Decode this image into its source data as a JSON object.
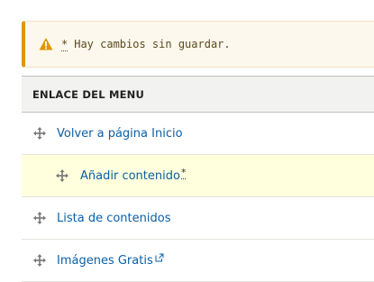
{
  "warning": {
    "asterisk": "*",
    "message": "Hay cambios sin guardar."
  },
  "table": {
    "header": "ENLACE DEL MENU",
    "rows": [
      {
        "label": "Volver a página Inicio",
        "indent": 0,
        "changed": "",
        "external": false,
        "highlighted": false
      },
      {
        "label": "Añadir contenido",
        "indent": 1,
        "changed": "*",
        "external": false,
        "highlighted": true
      },
      {
        "label": "Lista de contenidos",
        "indent": 0,
        "changed": "",
        "external": false,
        "highlighted": false
      },
      {
        "label": "Imágenes Gratis",
        "indent": 0,
        "changed": "",
        "external": true,
        "highlighted": false
      }
    ]
  },
  "colors": {
    "warning_accent": "#e09600",
    "warning_bg": "#fdf8ed",
    "link": "#0a5fa6",
    "highlight_row": "#ffffdd"
  },
  "icons": {
    "warning": "warning-triangle-icon",
    "drag": "drag-handle-icon",
    "external": "external-link-icon"
  }
}
